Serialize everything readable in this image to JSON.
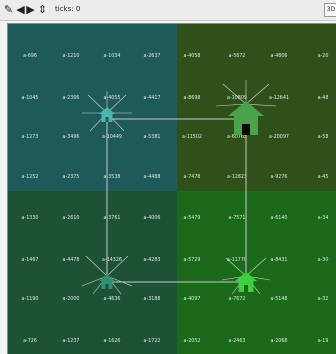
{
  "toolbar": {
    "ticks_label": "ticks: 0",
    "button_label": "3D"
  },
  "icons": [
    "pencil-icon",
    "left-arrow-icon",
    "right-arrow-icon",
    "up-down-arrow-icon"
  ],
  "colors": {
    "quadrant_top_left": "#1f5a5a",
    "quadrant_top_right": "#2f5019",
    "quadrant_bottom_left": "#1d5334",
    "quadrant_bottom_right": "#1a6a1a",
    "link": "#c8c8c8",
    "house_teal": "#4fb3b0",
    "house_green_large": "#4aa24a",
    "house_green_small": "#3fcf3f",
    "house_teal_dark": "#2f8f76"
  },
  "grid_rows": [
    [
      "a-696",
      "a-1210",
      "a-1034",
      "a-2637",
      "a-4058",
      "a-5672",
      "a-4806",
      "a-20"
    ],
    [
      "a-1045",
      "a-2306",
      "a-4055",
      "a-4417",
      "a-8698",
      "a-10809",
      "a-12641",
      "a-48"
    ],
    [
      "a-1273",
      "a-3496",
      "a-10449",
      "a-5381",
      "a-11502",
      "a-60765",
      "a-20097",
      "a-58"
    ],
    [
      "a-1252",
      "a-2375",
      "a-3538",
      "a-4488",
      "a-7478",
      "a-12823",
      "a-9276",
      "a-45"
    ],
    [
      "a-1330",
      "a-2610",
      "a-3761",
      "a-4006",
      "a-5479",
      "a-7571",
      "a-6140",
      "a-34"
    ],
    [
      "a-1467",
      "a-4478",
      "a-14326",
      "a-4283",
      "a-5729",
      "a-11770",
      "a-8431",
      "a-30"
    ],
    [
      "a-1190",
      "a-2000",
      "a-4636",
      "a-3188",
      "a-4097",
      "a-7672",
      "a-5148",
      "a-32"
    ],
    [
      "a-726",
      "a-1237",
      "a-1626",
      "a-1722",
      "a-2052",
      "a-2463",
      "a-2068",
      "a-19"
    ]
  ]
}
